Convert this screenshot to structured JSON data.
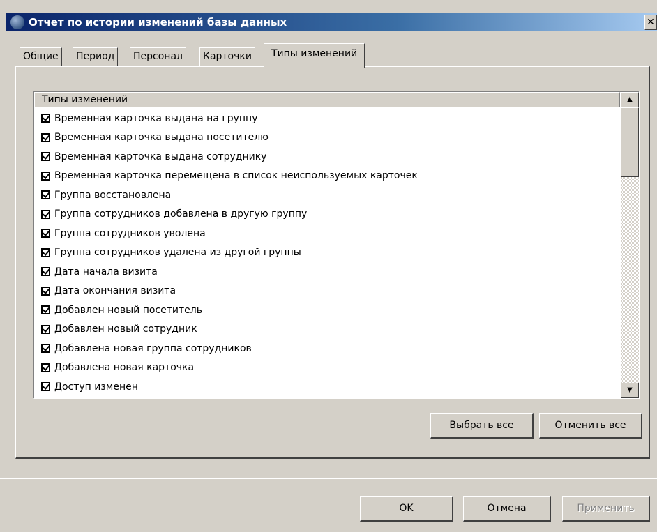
{
  "window": {
    "title": "Отчет по истории изменений базы данных",
    "close_label": "✕"
  },
  "tabs": [
    {
      "label": "Общие",
      "active": false
    },
    {
      "label": "Период",
      "active": false
    },
    {
      "label": "Персонал",
      "active": false
    },
    {
      "label": "Карточки",
      "active": false
    },
    {
      "label": "Типы изменений",
      "active": true
    }
  ],
  "list": {
    "header": "Типы изменений",
    "items": [
      {
        "label": "Временная карточка выдана на группу",
        "checked": true
      },
      {
        "label": "Временная карточка выдана посетителю",
        "checked": true
      },
      {
        "label": "Временная карточка выдана сотруднику",
        "checked": true
      },
      {
        "label": "Временная карточка перемещена в список неиспользуемых карточек",
        "checked": true
      },
      {
        "label": "Группа восстановлена",
        "checked": true
      },
      {
        "label": "Группа сотрудников добавлена в другую группу",
        "checked": true
      },
      {
        "label": "Группа сотрудников уволена",
        "checked": true
      },
      {
        "label": "Группа сотрудников удалена из другой группы",
        "checked": true
      },
      {
        "label": "Дата начала визита",
        "checked": true
      },
      {
        "label": "Дата окончания визита",
        "checked": true
      },
      {
        "label": "Добавлен новый посетитель",
        "checked": true
      },
      {
        "label": "Добавлен новый сотрудник",
        "checked": true
      },
      {
        "label": "Добавлена новая группа сотрудников",
        "checked": true
      },
      {
        "label": "Добавлена новая карточка",
        "checked": true
      },
      {
        "label": "Доступ изменен",
        "checked": true
      }
    ],
    "scroll_up_glyph": "▲",
    "scroll_down_glyph": "▼"
  },
  "buttons": {
    "select_all": "Выбрать все",
    "deselect_all": "Отменить все",
    "ok": "OK",
    "cancel": "Отмена",
    "apply": "Применить"
  }
}
